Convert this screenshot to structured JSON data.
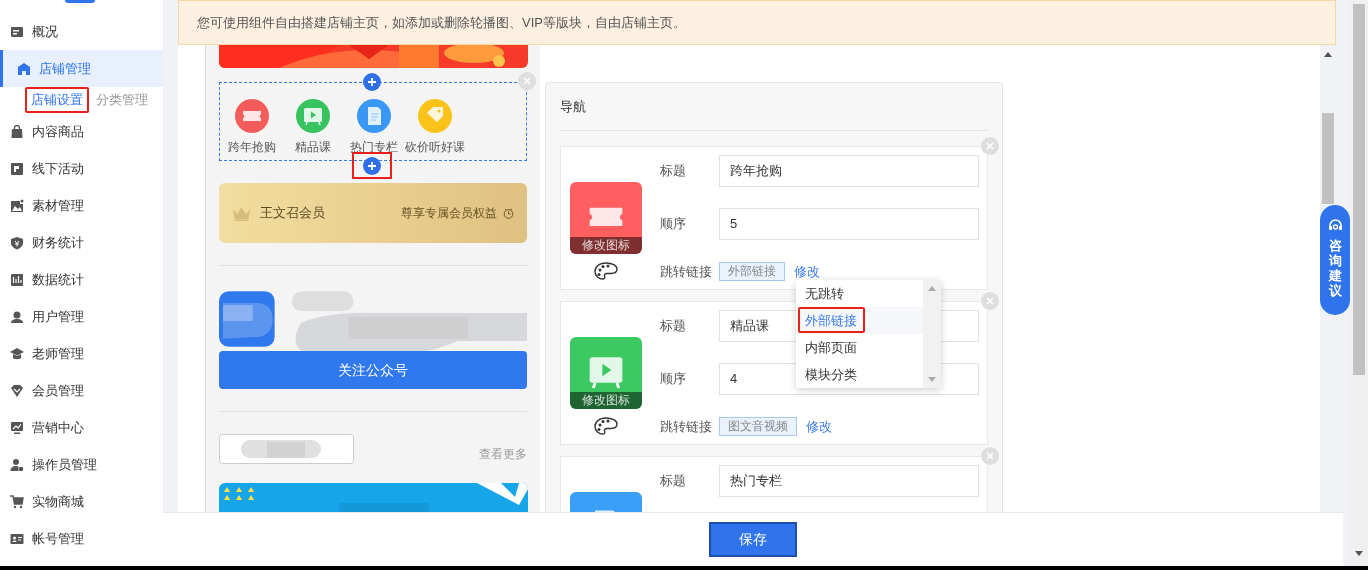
{
  "sidebar": {
    "items": [
      {
        "label": "概况",
        "selected": false
      },
      {
        "label": "店铺管理",
        "selected": true,
        "children": [
          {
            "label": "店铺设置",
            "selected": true,
            "highlighted": true
          },
          {
            "label": "分类管理",
            "selected": false,
            "highlighted": false
          }
        ]
      },
      {
        "label": "内容商品",
        "selected": false
      },
      {
        "label": "线下活动",
        "selected": false
      },
      {
        "label": "素材管理",
        "selected": false
      },
      {
        "label": "财务统计",
        "selected": false
      },
      {
        "label": "数据统计",
        "selected": false
      },
      {
        "label": "用户管理",
        "selected": false
      },
      {
        "label": "老师管理",
        "selected": false
      },
      {
        "label": "会员管理",
        "selected": false
      },
      {
        "label": "营销中心",
        "selected": false
      },
      {
        "label": "操作员管理",
        "selected": false
      },
      {
        "label": "实物商城",
        "selected": false
      },
      {
        "label": "帐号管理",
        "selected": false
      }
    ]
  },
  "notice": "您可使用组件自由搭建店铺主页，如添加或删除轮播图、VIP等版块，自由店铺主页。",
  "preview": {
    "nav": {
      "add_buttons": [
        {
          "highlighted": false
        },
        {
          "highlighted": true
        }
      ],
      "items": [
        {
          "label": "跨年抢购",
          "color": "#f45b5b"
        },
        {
          "label": "精品课",
          "color": "#37c35e"
        },
        {
          "label": "热门专栏",
          "color": "#3898f4"
        },
        {
          "label": "砍价听好课",
          "color": "#fbc31a"
        }
      ]
    },
    "member_card": {
      "name": "王文召会员",
      "benefit": "尊享专属会员权益"
    },
    "follow_button": "关注公众号",
    "more_link": "查看更多"
  },
  "editor": {
    "title": "导航",
    "cards": [
      {
        "color": "#ff5f5f",
        "icon_caption": "修改图标",
        "title_label": "标题",
        "title_value": "跨年抢购",
        "order_label": "顺序",
        "order_value": "5",
        "link_label": "跳转链接",
        "link_value": "外部链接",
        "edit_link": "修改"
      },
      {
        "color": "#3cc962",
        "icon_caption": "修改图标",
        "title_label": "标题",
        "title_value": "精品课",
        "order_label": "顺序",
        "order_value": "4",
        "link_label": "跳转链接",
        "link_value": "图文音视频",
        "edit_link": "修改"
      },
      {
        "color": "#3aa0f7",
        "title_label": "标题",
        "title_value": "热门专栏"
      }
    ],
    "link_options": [
      {
        "label": "无跳转",
        "selected": false,
        "highlighted": false
      },
      {
        "label": "外部链接",
        "selected": true,
        "highlighted": true
      },
      {
        "label": "内部页面",
        "selected": false,
        "highlighted": false
      },
      {
        "label": "模块分类",
        "selected": false,
        "highlighted": false
      }
    ]
  },
  "save_button": "保存",
  "consult_button": "咨询建议"
}
